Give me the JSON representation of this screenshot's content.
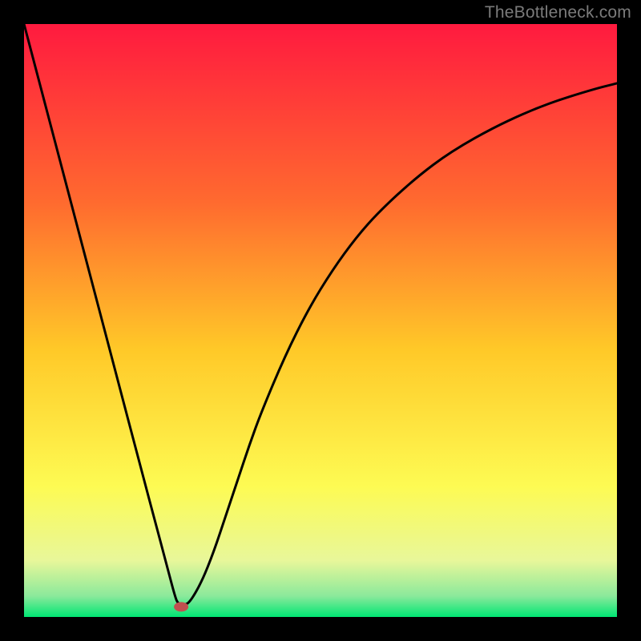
{
  "watermark": "TheBottleneck.com",
  "chart_data": {
    "type": "line",
    "title": "",
    "xlabel": "",
    "ylabel": "",
    "xlim": [
      0,
      100
    ],
    "ylim": [
      0,
      100
    ],
    "grid": false,
    "background_gradient_stops": [
      {
        "offset": 0.0,
        "color": "#ff1a3f"
      },
      {
        "offset": 0.3,
        "color": "#ff6a2f"
      },
      {
        "offset": 0.55,
        "color": "#ffc928"
      },
      {
        "offset": 0.78,
        "color": "#fdfb53"
      },
      {
        "offset": 0.905,
        "color": "#e8f79a"
      },
      {
        "offset": 0.965,
        "color": "#8ae99b"
      },
      {
        "offset": 1.0,
        "color": "#00e673"
      }
    ],
    "series": [
      {
        "name": "curve",
        "x": [
          0,
          5,
          10,
          15,
          20,
          22,
          24,
          25.5,
          26,
          27,
          28,
          30,
          32,
          34,
          36,
          38,
          40,
          44,
          48,
          52,
          56,
          60,
          66,
          72,
          80,
          88,
          96,
          100
        ],
        "y": [
          100,
          81,
          62,
          43,
          24,
          16.5,
          9,
          3.3,
          2.2,
          2.0,
          2.5,
          6,
          11,
          17,
          23,
          29,
          34.5,
          44,
          52,
          58.5,
          64,
          68.5,
          74,
          78.5,
          83,
          86.5,
          89,
          90
        ]
      }
    ],
    "marker": {
      "x": 26.5,
      "y": 1.7,
      "color": "#c1504f"
    }
  }
}
